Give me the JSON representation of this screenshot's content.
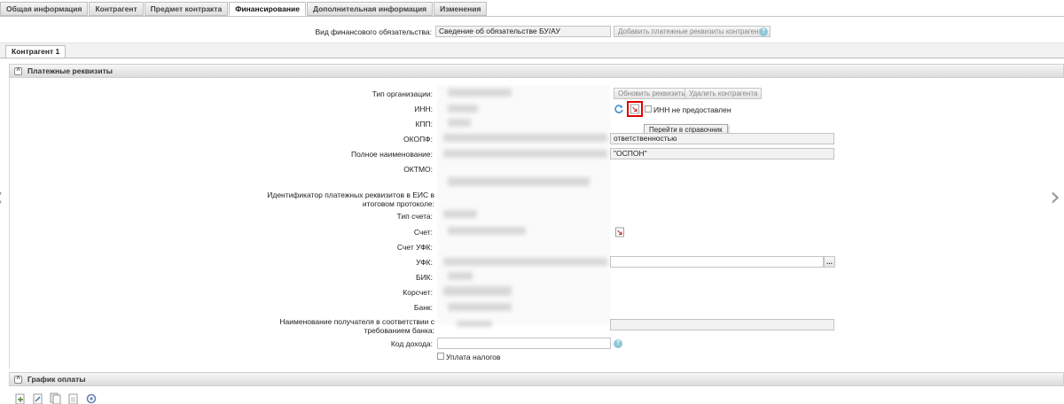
{
  "tabs": [
    {
      "label": "Общая информация",
      "active": false
    },
    {
      "label": "Контрагент",
      "active": false
    },
    {
      "label": "Предмет контракта",
      "active": false
    },
    {
      "label": "Финансирование",
      "active": true
    },
    {
      "label": "Дополнительная информация",
      "active": false
    },
    {
      "label": "Изменения",
      "active": false
    }
  ],
  "obligation": {
    "label": "Вид финансового обязательства:",
    "value": "Сведение об обязательстве БУ/АУ",
    "add_button": "Добавить платежные реквизиты контрагента"
  },
  "subtab": {
    "label": "Контрагент 1"
  },
  "payment_section": {
    "title": "Платежные реквизиты",
    "update_button": "Обновить реквизиты",
    "delete_button": "Удалить контрагента",
    "fields": {
      "org_type": "Тип организации:",
      "inn": "ИНН:",
      "kpp": "КПП:",
      "okopf": "ОКОПФ:",
      "full_name": "Полное наименование:",
      "oktmo": "ОКТМО:",
      "eis_id": "Идентификатор платежных реквизитов в ЕИС в итоговом протоколе:",
      "account_type": "Тип счета:",
      "account": "Счет:",
      "ufk_account": "Счет УФК:",
      "ufk": "УФК:",
      "bik": "БИК:",
      "corr_account": "Корсчет:",
      "bank": "Банк:",
      "recipient_name": "Наименование получателя в соответствии с требованием банка:",
      "income_code": "Код дохода:"
    },
    "okopf_value": "ответственностью",
    "full_name_value": "\"ОСПОН\"",
    "inn_not_provided": "ИНН не предоставлен",
    "taxes_payment": "Уплата налогов",
    "tooltip": "Перейти в справочник",
    "ufk_picker": "..."
  },
  "schedule_section": {
    "title": "График оплаты"
  },
  "icons": {
    "help": "question-icon",
    "refresh": "refresh-icon",
    "directory": "directory-link-icon"
  },
  "colors": {
    "highlight": "#e00000",
    "help": "#8ec7d8"
  }
}
